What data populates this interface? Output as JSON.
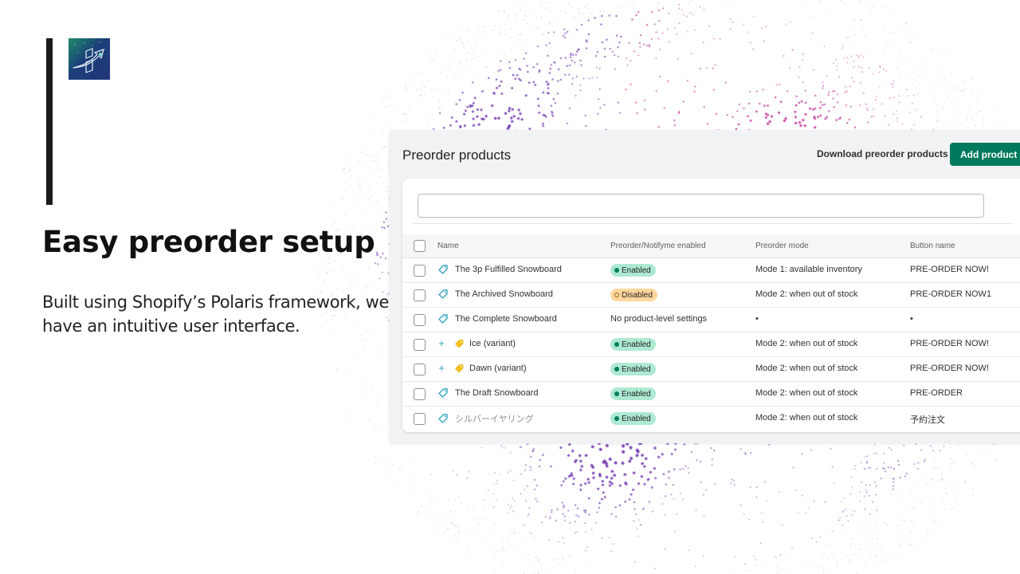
{
  "slide": {
    "headline": "Easy preorder setup",
    "subtext": "Built using Shopify’s Polaris framework, we have an intuitive user interface.",
    "logo_icon": "growth-arrow-logo-icon"
  },
  "app": {
    "title": "Preorder products",
    "download_label": "Download preorder products",
    "add_label": "Add product",
    "accent_color": "#007a5c",
    "search": {
      "value": "",
      "placeholder": ""
    },
    "columns": {
      "name": "Name",
      "status": "Preorder/Notifyme enabled",
      "mode": "Preorder mode",
      "button": "Button name"
    },
    "rows": [
      {
        "name": "The 3p Fulfilled Snowboard",
        "type": "product",
        "icon": "tag-icon",
        "status": "Enabled",
        "status_kind": "enabled",
        "mode": "Mode 1: available inventory",
        "button": "PRE-ORDER NOW!"
      },
      {
        "name": "The Archived Snowboard",
        "type": "product",
        "icon": "tag-icon",
        "status": "Disabled",
        "status_kind": "disabled",
        "mode": "Mode 2: when out of stock",
        "button": "PRE-ORDER NOW1"
      },
      {
        "name": "The Complete Snowboard",
        "type": "product",
        "icon": "tag-icon",
        "status": "No product-level settings",
        "status_kind": "none",
        "mode": "•",
        "button": "•"
      },
      {
        "name": "Ice (variant)",
        "type": "variant",
        "icon": "variant-tag-icon",
        "status": "Enabled",
        "status_kind": "enabled",
        "mode": "Mode 2: when out of stock",
        "button": "PRE-ORDER NOW!"
      },
      {
        "name": "Dawn (variant)",
        "type": "variant",
        "icon": "variant-tag-icon",
        "status": "Enabled",
        "status_kind": "enabled",
        "mode": "Mode 2: when out of stock",
        "button": "PRE-ORDER NOW!"
      },
      {
        "name": "The Draft Snowboard",
        "type": "product",
        "icon": "tag-icon",
        "status": "Enabled",
        "status_kind": "enabled",
        "mode": "Mode 2: when out of stock",
        "button": "PRE-ORDER"
      },
      {
        "name": "シルバーイヤリング",
        "type": "product",
        "icon": "tag-icon",
        "faded": true,
        "status": "Enabled",
        "status_kind": "enabled",
        "mode": "Mode 2: when out of stock",
        "button": "予約注文"
      }
    ],
    "status_colors": {
      "enabled": "#aee9d1",
      "disabled": "#ffd79d"
    }
  }
}
